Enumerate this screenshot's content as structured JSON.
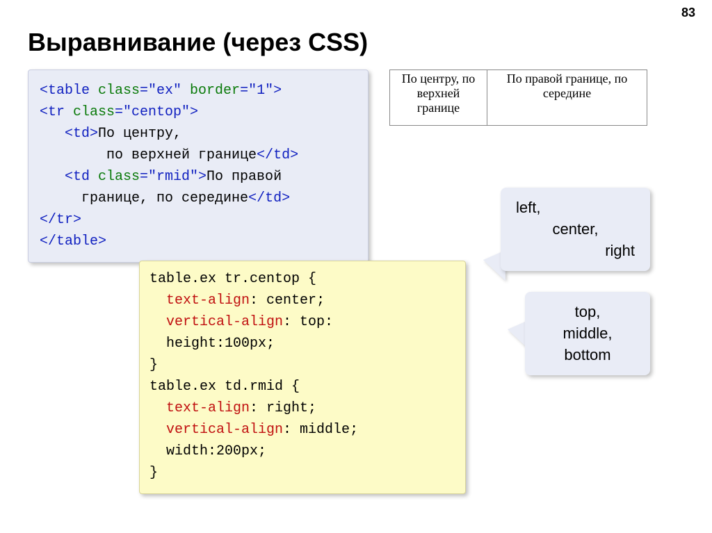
{
  "page_number": "83",
  "title": "Выравнивание (через CSS)",
  "code_html": {
    "l1a": "<table",
    "l1b": " class",
    "l1c": "=\"ex\"",
    "l1d": " border",
    "l1e": "=\"1\">",
    "l2a": "<tr",
    "l2b": " class",
    "l2c": "=\"centop\">",
    "l3a": "   <td>",
    "l3b": "По центру,",
    "l4": "        по верхней границе",
    "l4e": "</td>",
    "l5a": "   <td",
    "l5b": " class",
    "l5c": "=\"rmid\">",
    "l5d": "По правой",
    "l6": "     границе, по середине",
    "l6e": "</td>",
    "l7": "</tr>",
    "l8": "</table>"
  },
  "code_css": {
    "l1": "table.ex tr.centop {",
    "l2a": "  ",
    "l2b": "text-align",
    "l2c": ": center;",
    "l3a": "  ",
    "l3b": "vertical-align",
    "l3c": ": top:",
    "l4": "  height:100px;",
    "l5": "}",
    "l6": "table.ex td.rmid {",
    "l7a": "  ",
    "l7b": "text-align",
    "l7c": ": right;",
    "l8a": "  ",
    "l8b": "vertical-align",
    "l8c": ": middle;",
    "l9": "  width:200px;",
    "l10": "}"
  },
  "preview": {
    "cell1_line1": "По центру, по",
    "cell1_line2": "верхней",
    "cell1_line3": "границе",
    "cell2_line1": "По правой границе, по",
    "cell2_line2": "середине"
  },
  "callout1": {
    "l1": "left,",
    "l2": "center,",
    "l3": "right"
  },
  "callout2": {
    "l1": "top,",
    "l2": "middle,",
    "l3": "bottom"
  }
}
